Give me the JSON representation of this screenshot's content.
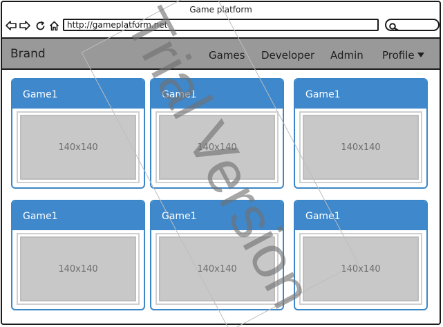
{
  "window": {
    "title": "Game platform"
  },
  "toolbar": {
    "url": "http://gameplatform.net"
  },
  "navbar": {
    "brand": "Brand",
    "items": [
      "Games",
      "Developer",
      "Admin",
      "Profile"
    ]
  },
  "cards": [
    {
      "title": "Game1",
      "image_label": "140x140"
    },
    {
      "title": "Game1",
      "image_label": "140x140"
    },
    {
      "title": "Game1",
      "image_label": "140x140"
    },
    {
      "title": "Game1",
      "image_label": "140x140"
    },
    {
      "title": "Game1",
      "image_label": "140x140"
    },
    {
      "title": "Game1",
      "image_label": "140x140"
    }
  ],
  "watermark": {
    "text": "Trial Version"
  },
  "colors": {
    "navbar_bg": "#999999",
    "card_header": "#3f88cc",
    "card_border": "#3a86c8",
    "placeholder_bg": "#c8c8c8"
  }
}
